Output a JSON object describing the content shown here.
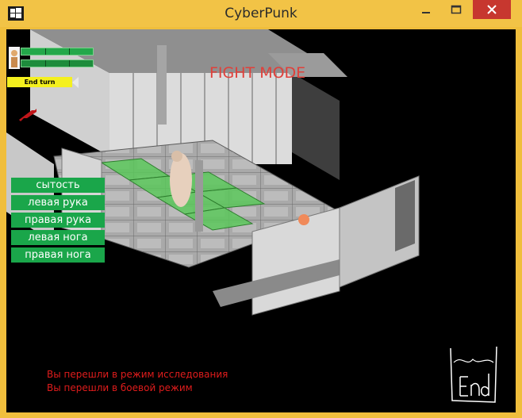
{
  "window": {
    "title": "CyberPunk",
    "icon": "windows-logo-icon",
    "controls": [
      "minimize-icon",
      "maximize-icon",
      "close-icon"
    ]
  },
  "hud": {
    "end_turn_label": "End turn",
    "mode_label": "FIGHT MODE",
    "bars": [
      {
        "name": "health",
        "color": "#24a84a"
      },
      {
        "name": "action-points",
        "color": "#1e8c3c"
      }
    ],
    "weapon_icon": "rifle-icon",
    "portrait_icon": "player-portrait-icon"
  },
  "status_buttons": [
    "сытость",
    "левая рука",
    "правая рука",
    "левая нога",
    "правая нога"
  ],
  "log": [
    "Вы перешли в режим исследования",
    "Вы перешли в боевой режим"
  ],
  "colors": {
    "titlebar": "#f2c346",
    "status_green": "#1aa64a",
    "log_red": "#e01c1c",
    "fight_red": "#e0403a",
    "end_turn_yellow": "#f4f01e",
    "close_red": "#c7372f"
  }
}
